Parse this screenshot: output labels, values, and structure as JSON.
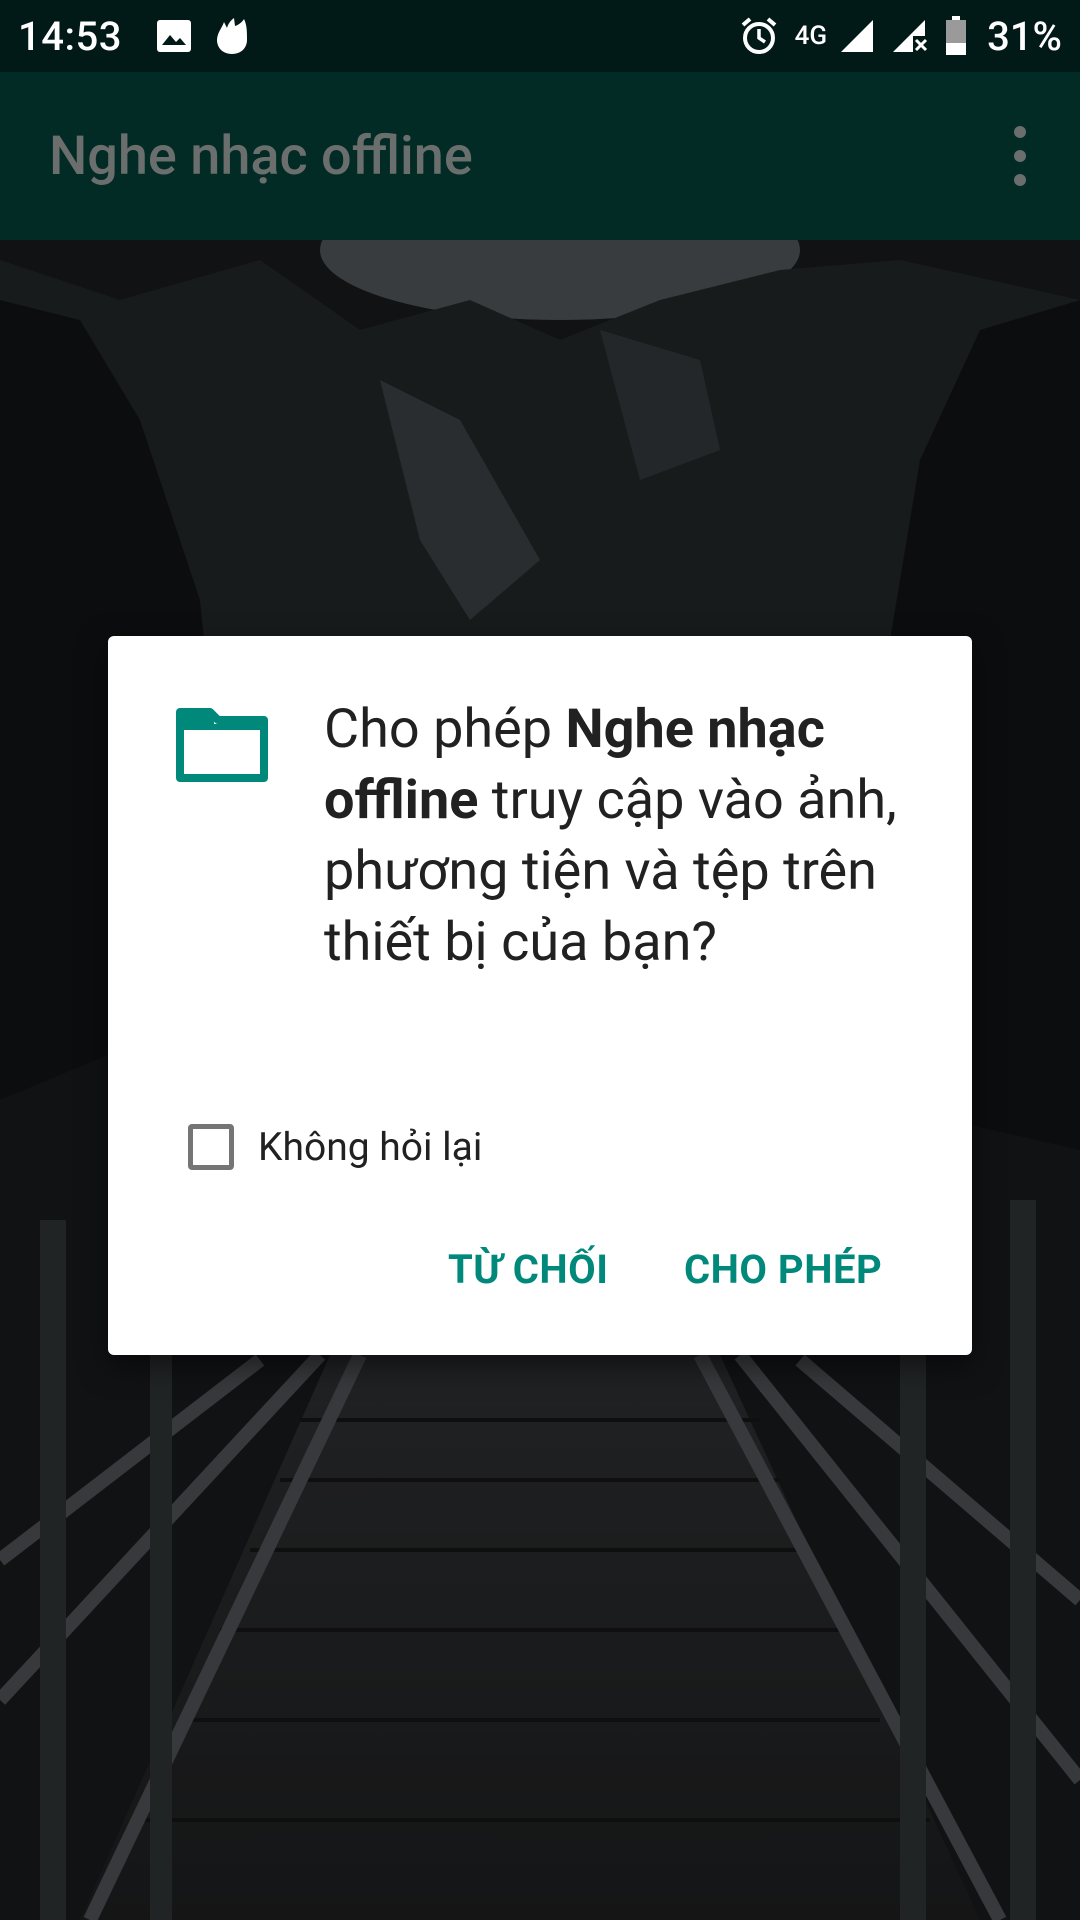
{
  "status_bar": {
    "time": "14:53",
    "network": "4G",
    "battery": "31%",
    "left_icons": [
      "image-icon",
      "app-notification-icon"
    ],
    "right_icons": [
      "alarm-icon",
      "signal-icon",
      "signal-no-data-icon",
      "battery-icon"
    ]
  },
  "app_bar": {
    "title": "Nghe nhạc offline",
    "menu_icon": "more-vert-icon"
  },
  "dialog": {
    "icon": "folder-icon",
    "message_prefix": "Cho phép ",
    "app_name": "Nghe nhạc offline",
    "message_suffix": " truy cập vào ảnh, phương tiện và tệp trên thiết bị của bạn?",
    "dont_ask_label": "Không hỏi lại",
    "dont_ask_checked": false,
    "deny_label": "TỪ CHỐI",
    "allow_label": "CHO PHÉP"
  },
  "colors": {
    "status_bar_bg": "#021a17",
    "app_bar_bg": "#022b26",
    "accent": "#00897b"
  }
}
